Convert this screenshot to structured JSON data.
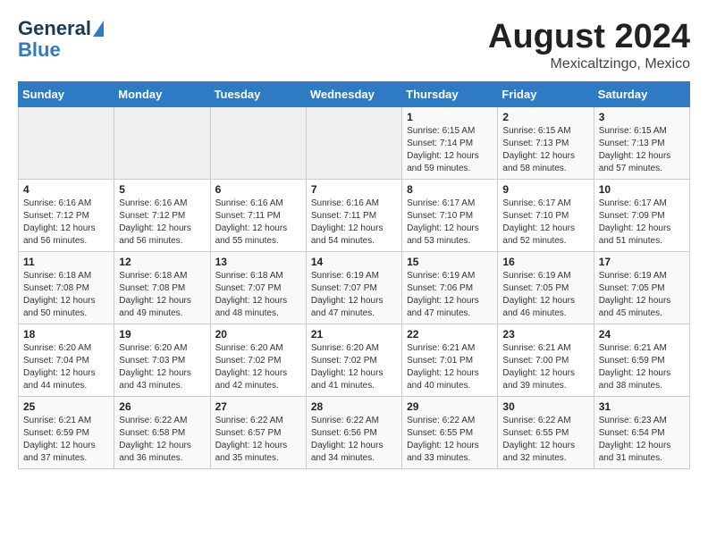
{
  "logo": {
    "general": "General",
    "blue": "Blue"
  },
  "title": "August 2024",
  "subtitle": "Mexicaltzingo, Mexico",
  "days_header": [
    "Sunday",
    "Monday",
    "Tuesday",
    "Wednesday",
    "Thursday",
    "Friday",
    "Saturday"
  ],
  "weeks": [
    [
      {
        "day": "",
        "sunrise": "",
        "sunset": "",
        "daylight": ""
      },
      {
        "day": "",
        "sunrise": "",
        "sunset": "",
        "daylight": ""
      },
      {
        "day": "",
        "sunrise": "",
        "sunset": "",
        "daylight": ""
      },
      {
        "day": "",
        "sunrise": "",
        "sunset": "",
        "daylight": ""
      },
      {
        "day": "1",
        "sunrise": "Sunrise: 6:15 AM",
        "sunset": "Sunset: 7:14 PM",
        "daylight": "Daylight: 12 hours and 59 minutes."
      },
      {
        "day": "2",
        "sunrise": "Sunrise: 6:15 AM",
        "sunset": "Sunset: 7:13 PM",
        "daylight": "Daylight: 12 hours and 58 minutes."
      },
      {
        "day": "3",
        "sunrise": "Sunrise: 6:15 AM",
        "sunset": "Sunset: 7:13 PM",
        "daylight": "Daylight: 12 hours and 57 minutes."
      }
    ],
    [
      {
        "day": "4",
        "sunrise": "Sunrise: 6:16 AM",
        "sunset": "Sunset: 7:12 PM",
        "daylight": "Daylight: 12 hours and 56 minutes."
      },
      {
        "day": "5",
        "sunrise": "Sunrise: 6:16 AM",
        "sunset": "Sunset: 7:12 PM",
        "daylight": "Daylight: 12 hours and 56 minutes."
      },
      {
        "day": "6",
        "sunrise": "Sunrise: 6:16 AM",
        "sunset": "Sunset: 7:11 PM",
        "daylight": "Daylight: 12 hours and 55 minutes."
      },
      {
        "day": "7",
        "sunrise": "Sunrise: 6:16 AM",
        "sunset": "Sunset: 7:11 PM",
        "daylight": "Daylight: 12 hours and 54 minutes."
      },
      {
        "day": "8",
        "sunrise": "Sunrise: 6:17 AM",
        "sunset": "Sunset: 7:10 PM",
        "daylight": "Daylight: 12 hours and 53 minutes."
      },
      {
        "day": "9",
        "sunrise": "Sunrise: 6:17 AM",
        "sunset": "Sunset: 7:10 PM",
        "daylight": "Daylight: 12 hours and 52 minutes."
      },
      {
        "day": "10",
        "sunrise": "Sunrise: 6:17 AM",
        "sunset": "Sunset: 7:09 PM",
        "daylight": "Daylight: 12 hours and 51 minutes."
      }
    ],
    [
      {
        "day": "11",
        "sunrise": "Sunrise: 6:18 AM",
        "sunset": "Sunset: 7:08 PM",
        "daylight": "Daylight: 12 hours and 50 minutes."
      },
      {
        "day": "12",
        "sunrise": "Sunrise: 6:18 AM",
        "sunset": "Sunset: 7:08 PM",
        "daylight": "Daylight: 12 hours and 49 minutes."
      },
      {
        "day": "13",
        "sunrise": "Sunrise: 6:18 AM",
        "sunset": "Sunset: 7:07 PM",
        "daylight": "Daylight: 12 hours and 48 minutes."
      },
      {
        "day": "14",
        "sunrise": "Sunrise: 6:19 AM",
        "sunset": "Sunset: 7:07 PM",
        "daylight": "Daylight: 12 hours and 47 minutes."
      },
      {
        "day": "15",
        "sunrise": "Sunrise: 6:19 AM",
        "sunset": "Sunset: 7:06 PM",
        "daylight": "Daylight: 12 hours and 47 minutes."
      },
      {
        "day": "16",
        "sunrise": "Sunrise: 6:19 AM",
        "sunset": "Sunset: 7:05 PM",
        "daylight": "Daylight: 12 hours and 46 minutes."
      },
      {
        "day": "17",
        "sunrise": "Sunrise: 6:19 AM",
        "sunset": "Sunset: 7:05 PM",
        "daylight": "Daylight: 12 hours and 45 minutes."
      }
    ],
    [
      {
        "day": "18",
        "sunrise": "Sunrise: 6:20 AM",
        "sunset": "Sunset: 7:04 PM",
        "daylight": "Daylight: 12 hours and 44 minutes."
      },
      {
        "day": "19",
        "sunrise": "Sunrise: 6:20 AM",
        "sunset": "Sunset: 7:03 PM",
        "daylight": "Daylight: 12 hours and 43 minutes."
      },
      {
        "day": "20",
        "sunrise": "Sunrise: 6:20 AM",
        "sunset": "Sunset: 7:02 PM",
        "daylight": "Daylight: 12 hours and 42 minutes."
      },
      {
        "day": "21",
        "sunrise": "Sunrise: 6:20 AM",
        "sunset": "Sunset: 7:02 PM",
        "daylight": "Daylight: 12 hours and 41 minutes."
      },
      {
        "day": "22",
        "sunrise": "Sunrise: 6:21 AM",
        "sunset": "Sunset: 7:01 PM",
        "daylight": "Daylight: 12 hours and 40 minutes."
      },
      {
        "day": "23",
        "sunrise": "Sunrise: 6:21 AM",
        "sunset": "Sunset: 7:00 PM",
        "daylight": "Daylight: 12 hours and 39 minutes."
      },
      {
        "day": "24",
        "sunrise": "Sunrise: 6:21 AM",
        "sunset": "Sunset: 6:59 PM",
        "daylight": "Daylight: 12 hours and 38 minutes."
      }
    ],
    [
      {
        "day": "25",
        "sunrise": "Sunrise: 6:21 AM",
        "sunset": "Sunset: 6:59 PM",
        "daylight": "Daylight: 12 hours and 37 minutes."
      },
      {
        "day": "26",
        "sunrise": "Sunrise: 6:22 AM",
        "sunset": "Sunset: 6:58 PM",
        "daylight": "Daylight: 12 hours and 36 minutes."
      },
      {
        "day": "27",
        "sunrise": "Sunrise: 6:22 AM",
        "sunset": "Sunset: 6:57 PM",
        "daylight": "Daylight: 12 hours and 35 minutes."
      },
      {
        "day": "28",
        "sunrise": "Sunrise: 6:22 AM",
        "sunset": "Sunset: 6:56 PM",
        "daylight": "Daylight: 12 hours and 34 minutes."
      },
      {
        "day": "29",
        "sunrise": "Sunrise: 6:22 AM",
        "sunset": "Sunset: 6:55 PM",
        "daylight": "Daylight: 12 hours and 33 minutes."
      },
      {
        "day": "30",
        "sunrise": "Sunrise: 6:22 AM",
        "sunset": "Sunset: 6:55 PM",
        "daylight": "Daylight: 12 hours and 32 minutes."
      },
      {
        "day": "31",
        "sunrise": "Sunrise: 6:23 AM",
        "sunset": "Sunset: 6:54 PM",
        "daylight": "Daylight: 12 hours and 31 minutes."
      }
    ]
  ]
}
